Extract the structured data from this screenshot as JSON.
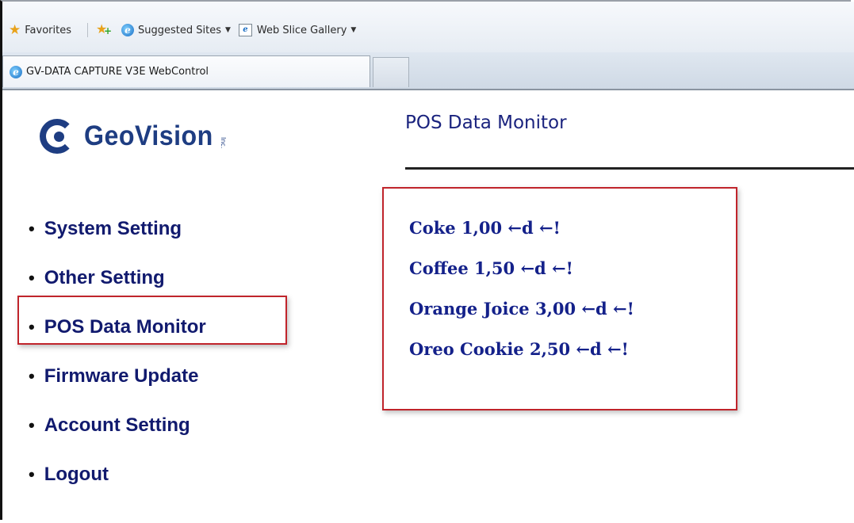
{
  "favorites_bar": {
    "favorites_label": "Favorites",
    "suggested_sites_label": "Suggested Sites",
    "web_slice_gallery_label": "Web Slice Gallery"
  },
  "tabs": [
    {
      "label": "GV-DATA CAPTURE V3E WebControl"
    }
  ],
  "logo": {
    "text": "GeoVision",
    "suffix": "Inc."
  },
  "menu": {
    "items": [
      {
        "label": "System Setting"
      },
      {
        "label": "Other Setting"
      },
      {
        "label": "POS Data Monitor"
      },
      {
        "label": "Firmware Update"
      },
      {
        "label": "Account Setting"
      },
      {
        "label": "Logout"
      }
    ]
  },
  "page": {
    "title": "POS Data Monitor",
    "data_lines": [
      "Coke 1,00 ←d  ←!",
      "Coffee 1,50 ←d  ←!",
      "Orange Joice 3,00 ←d  ←!",
      "Oreo Cookie 2,50 ←d  ←!"
    ]
  },
  "colors": {
    "menu_text": "#1a237e",
    "highlight": "#c0242b",
    "logo": "#1e3d82"
  }
}
